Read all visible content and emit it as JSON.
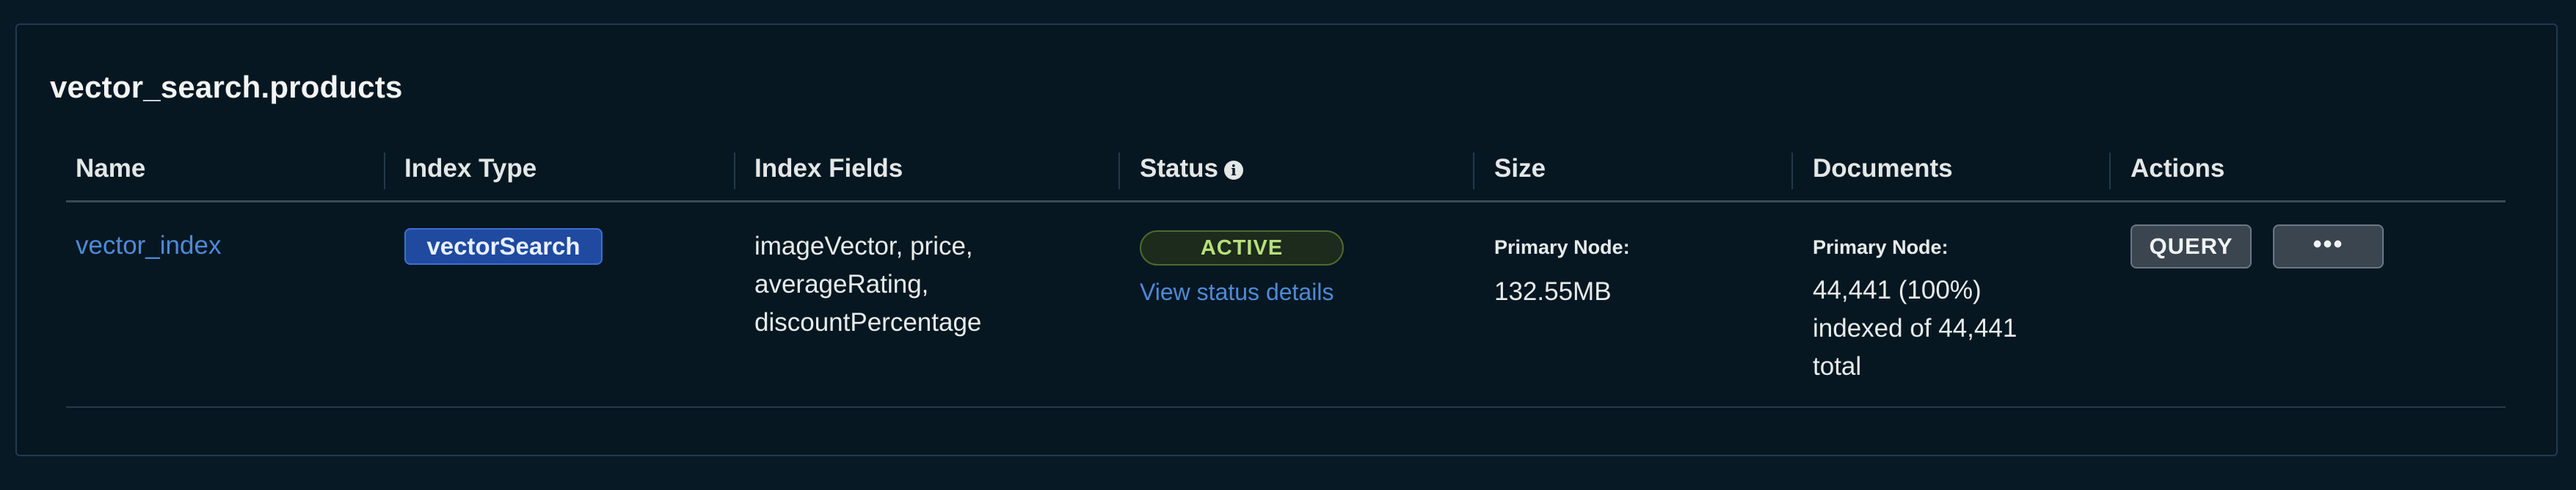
{
  "collection_title": "vector_search.products",
  "columns": {
    "name": "Name",
    "index_type": "Index Type",
    "index_fields": "Index Fields",
    "status": "Status",
    "size": "Size",
    "documents": "Documents",
    "actions": "Actions"
  },
  "row": {
    "name": "vector_index",
    "index_type": "vectorSearch",
    "index_fields_lines": [
      "imageVector, price,",
      "averageRating,",
      "discountPercentage"
    ],
    "status_badge": "ACTIVE",
    "status_link": "View status details",
    "size_label": "Primary Node:",
    "size_value": "132.55MB",
    "documents_label": "Primary Node:",
    "documents_lines": [
      "44,441 (100%)",
      "indexed of 44,441",
      "total"
    ],
    "query_button": "QUERY",
    "more_button": "•••"
  },
  "icons": {
    "status_info": "info-icon"
  },
  "colors": {
    "background": "#081926",
    "link": "#4d8ad8",
    "badge_type": "#1f4aa0",
    "status_active": "#b8e07a"
  }
}
